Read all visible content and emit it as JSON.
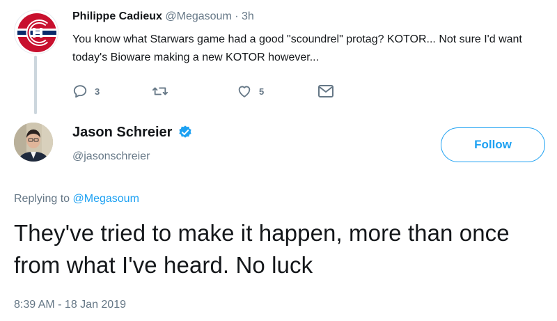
{
  "parent_tweet": {
    "author_name": "Philippe Cadieux",
    "handle": "@Megasoum",
    "separator": "·",
    "time_ago": "3h",
    "text": "You know what Starwars game had a good \"scoundrel\" protag? KOTOR... Not sure I'd want today's Bioware making a new KOTOR however...",
    "avatar_icon": "montreal-canadiens-logo-icon",
    "actions": {
      "reply_count": "3",
      "retweet_count": "",
      "like_count": "5"
    }
  },
  "main_tweet": {
    "author_name": "Jason Schreier",
    "verified": true,
    "handle": "@jasonschreier",
    "follow_label": "Follow",
    "replying_prefix": "Replying to",
    "replying_to": "@Megasoum",
    "text": "They've tried to make it happen, more than once from what I've heard. No luck",
    "timestamp": "8:39 AM - 18 Jan 2019"
  },
  "colors": {
    "accent": "#1da1f2",
    "secondary_text": "#657786",
    "primary_text": "#14171a",
    "thread_line": "#ccd6dd",
    "canadiens_red": "#c8102e",
    "canadiens_blue": "#0b2a6b"
  }
}
